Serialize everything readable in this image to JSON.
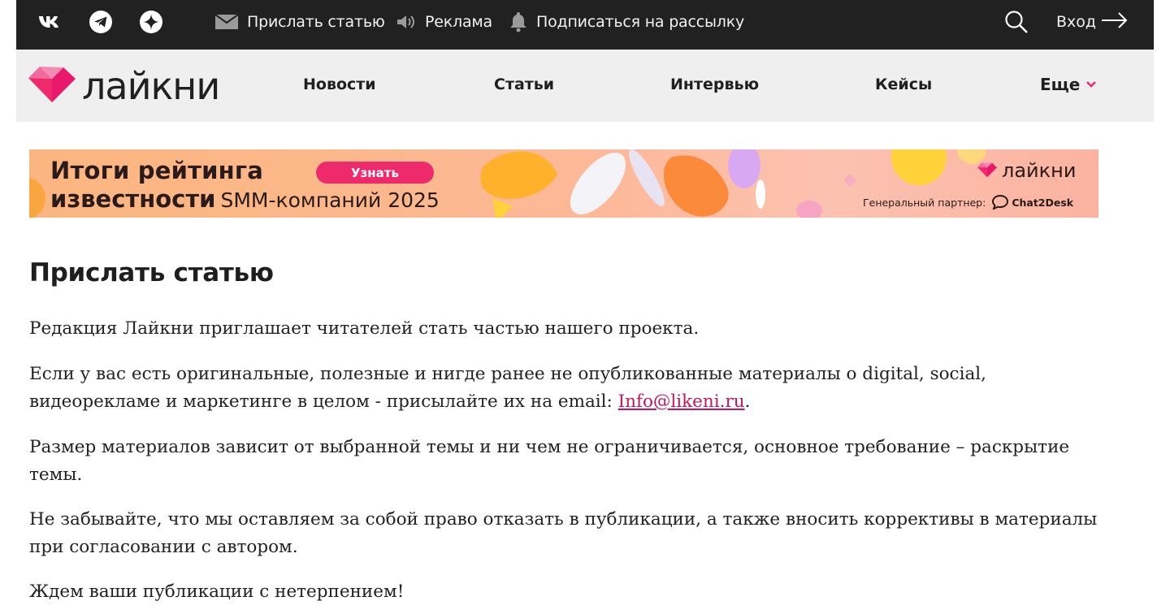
{
  "topbar": {
    "social": [
      {
        "name": "vk-icon"
      },
      {
        "name": "telegram-icon"
      },
      {
        "name": "zen-icon"
      }
    ],
    "send_article": "Прислать статью",
    "ads": "Реклама",
    "subscribe": "Подписаться на рассылку",
    "login": "Вход"
  },
  "brand": {
    "logo_text": "лайкни",
    "accent": "#ee2a6d"
  },
  "nav": {
    "items": [
      "Новости",
      "Статьи",
      "Интервью",
      "Кейсы"
    ],
    "more": "Еще"
  },
  "banner": {
    "title_line1": "Итоги рейтинга",
    "title_line2_bold": "известности",
    "title_line2_light": "SMM-компаний 2025",
    "button": "Узнать",
    "brand": "лайкни",
    "partner_label": "Генеральный партнер:",
    "partner_name": "Chat2Desk"
  },
  "article": {
    "title": "Прислать статью",
    "p1": "Редакция Лайкни приглашает читателей стать частью нашего проекта.",
    "p2_line1": "Если у вас есть оригинальные, полезные и нигде ранее не опубликованные материалы о digital, social,",
    "p2_line2_before": "видеорекламе и маркетинге в целом - присылайте их на email: ",
    "p2_email": "Info@likeni.ru",
    "p2_after": ".",
    "p3": "Размер материалов зависит от выбранной темы и ни чем не ограничивается, основное требование – раскрытие темы.",
    "p4": "Не забывайте, что мы оставляем за собой право отказать в публикации, а также вносить коррективы в материалы при согласовании с автором.",
    "p5": "Ждем ваши публикации с нетерпением!"
  }
}
